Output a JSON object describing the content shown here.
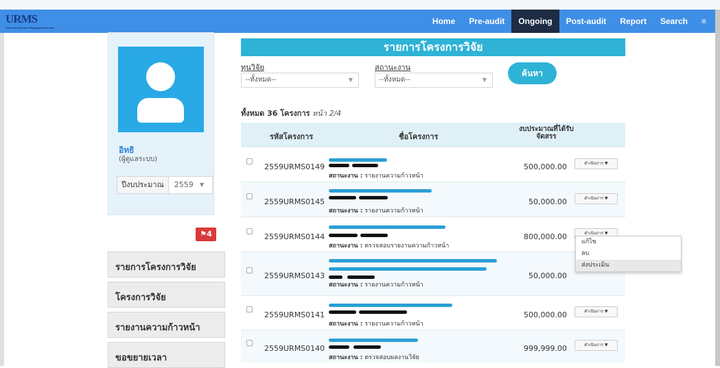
{
  "app": {
    "logo": "URMS"
  },
  "nav": [
    {
      "label": "Home",
      "active": false
    },
    {
      "label": "Pre-audit",
      "active": false
    },
    {
      "label": "Ongoing",
      "active": true
    },
    {
      "label": "Post-audit",
      "active": false
    },
    {
      "label": "Report",
      "active": false
    },
    {
      "label": "Search",
      "active": false
    },
    {
      "label": "≡",
      "active": false
    }
  ],
  "profile": {
    "name": "อิทธิ",
    "role": "(ผู้ดูแลระบบ)",
    "year_label": "ปีงบประมาณ",
    "year_value": "2559"
  },
  "badge": {
    "text": "4"
  },
  "sidebar": [
    {
      "label": "รายการโครงการวิจัย"
    },
    {
      "label": "โครงการวิจัย"
    },
    {
      "label": "รายงานความก้าวหน้า"
    },
    {
      "label": "ขอขยายเวลา"
    }
  ],
  "page": {
    "title": "รายการโครงการวิจัย"
  },
  "filters": {
    "fund_label": "ทุนวิจัย",
    "fund_value": "--ทั้งหมด--",
    "status_label": "สถานะงาน",
    "status_value": "--ทั้งหมด--",
    "search_button": "ค้นหา"
  },
  "summary": {
    "total": "ทั้งหมด 36 โครงการ",
    "page": "หน้า 2/4"
  },
  "table": {
    "headers": {
      "code": "รหัสโครงการ",
      "name": "ชื่อโครงการ",
      "budget": "งบประมาณที่ได้รับจัดสรร"
    },
    "status_prefix": "สถานะงาน :",
    "action_label": "ดำเนินการ ▼",
    "rows": [
      {
        "code": "2559URMS0149",
        "status": "รายงานความก้าวหน้า",
        "budget": "500,000.00"
      },
      {
        "code": "2559URMS0145",
        "status": "รายงานความก้าวหน้า",
        "budget": "50,000.00"
      },
      {
        "code": "2559URMS0144",
        "status": "ตรวจสอบรายงานความก้าวหน้า",
        "budget": "800,000.00"
      },
      {
        "code": "2559URMS0143",
        "status": "รายงานความก้าวหน้า",
        "budget": "50,000.00"
      },
      {
        "code": "2559URMS0141",
        "status": "รายงานความก้าวหน้า",
        "budget": "500,000.00"
      },
      {
        "code": "2559URMS0140",
        "status": "ตรวจสอบผลงานวิจัย",
        "budget": "999,999.00"
      }
    ]
  },
  "dropdown": {
    "items": [
      "แก้ไข",
      "ลบ",
      "ส่งประเมิน"
    ]
  }
}
